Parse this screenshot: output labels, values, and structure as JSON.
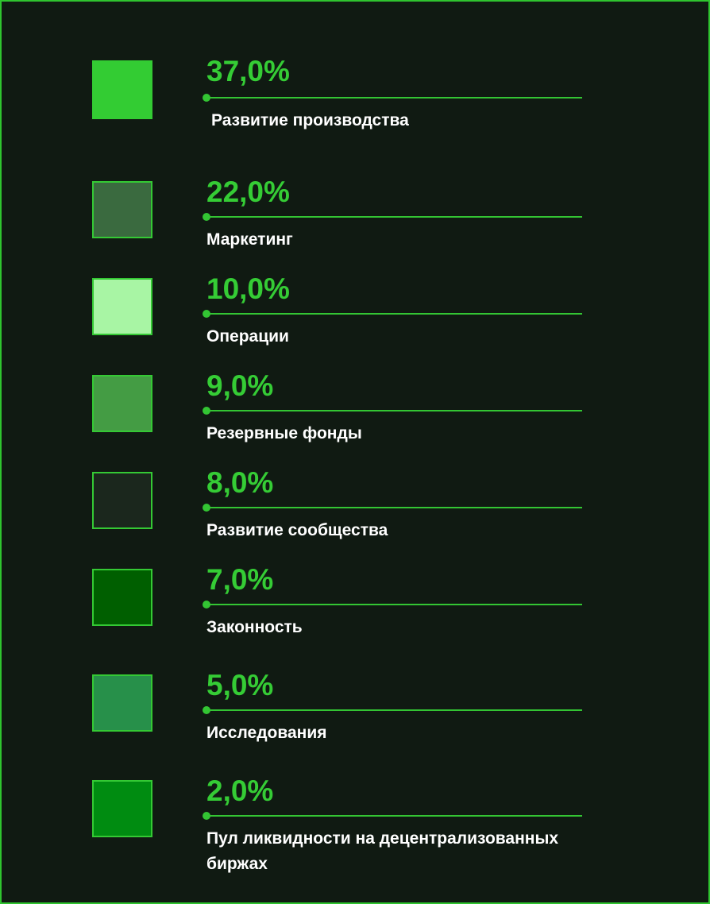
{
  "chart_data": {
    "type": "table",
    "unit": "%",
    "items": [
      {
        "value_label": "37,0%",
        "value": 37.0,
        "label": "Развитие производства",
        "color": "#33cc33"
      },
      {
        "value_label": "22,0%",
        "value": 22.0,
        "label": "Маркетинг",
        "color": "#3a6a3f"
      },
      {
        "value_label": "10,0%",
        "value": 10.0,
        "label": "Операции",
        "color": "#a8f5a4"
      },
      {
        "value_label": "9,0%",
        "value": 9.0,
        "label": "Резервные фонды",
        "color": "#449c44"
      },
      {
        "value_label": "8,0%",
        "value": 8.0,
        "label": "Развитие сообщества",
        "color": "#1b271d"
      },
      {
        "value_label": "7,0%",
        "value": 7.0,
        "label": "Законность",
        "color": "#005f00"
      },
      {
        "value_label": "5,0%",
        "value": 5.0,
        "label": "Исследования",
        "color": "#27904a"
      },
      {
        "value_label": "2,0%",
        "value": 2.0,
        "label": "Пул ликвидности на децентрализованных биржах",
        "color": "#008c11"
      }
    ]
  },
  "colors": {
    "background": "#101a12",
    "accent": "#35cc35",
    "text": "#ffffff"
  }
}
